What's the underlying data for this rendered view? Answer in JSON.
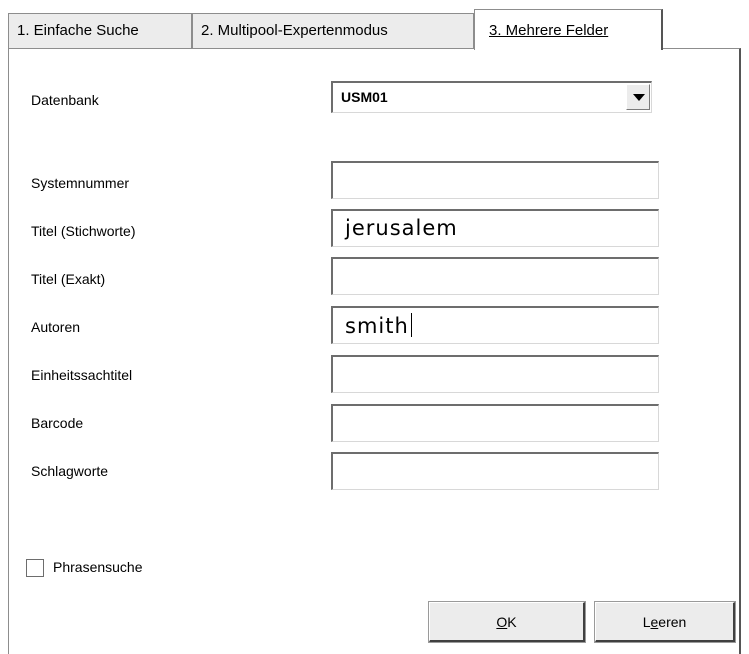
{
  "tabs": [
    {
      "label": "1. Einfache Suche"
    },
    {
      "label": "2. Multipool-Expertenmodus"
    },
    {
      "label": "3. Mehrere Felder",
      "active": true
    }
  ],
  "database": {
    "label": "Datenbank",
    "selected": "USM01"
  },
  "fields": [
    {
      "label": "Systemnummer",
      "value": ""
    },
    {
      "label": "Titel (Stichworte)",
      "value": "jerusalem"
    },
    {
      "label": "Titel (Exakt)",
      "value": ""
    },
    {
      "label": "Autoren",
      "value": "smith"
    },
    {
      "label": "Einheitssachtitel",
      "value": ""
    },
    {
      "label": "Barcode",
      "value": ""
    },
    {
      "label": "Schlagworte",
      "value": ""
    }
  ],
  "phrase_search": {
    "label": "Phrasensuche",
    "checked": false
  },
  "buttons": {
    "ok": {
      "mnemonic": "O",
      "rest": "K"
    },
    "clear": {
      "pre": "L",
      "mnemonic": "e",
      "rest": "eren"
    }
  },
  "icons": {
    "dropdown": "chevron-down-icon"
  }
}
